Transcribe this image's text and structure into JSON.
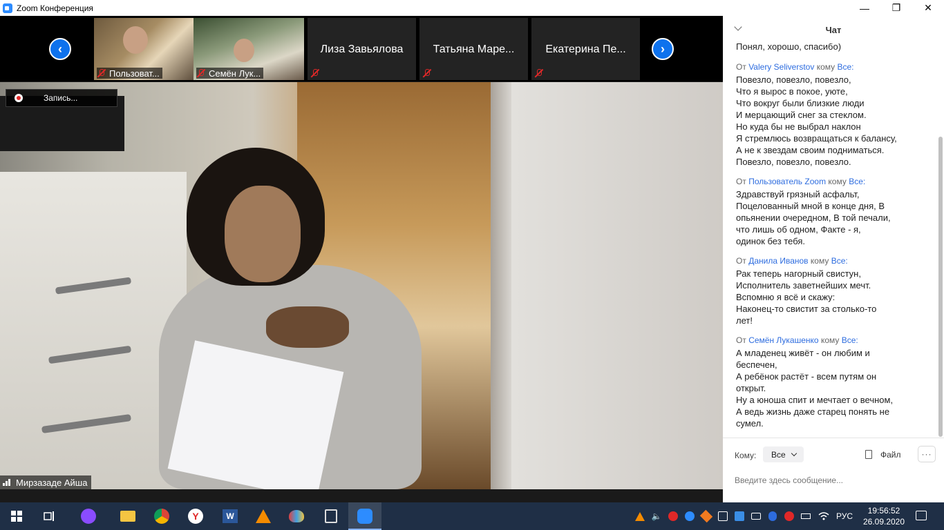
{
  "window": {
    "title": "Zoom Конференция",
    "minimize": "—",
    "maximize": "❐",
    "close": "✕"
  },
  "thumbnails": [
    {
      "name": "Пользоват...",
      "has_video": true
    },
    {
      "name": "Семён Лук...",
      "has_video": true
    },
    {
      "name": "Лиза Завьялова",
      "has_video": false
    },
    {
      "name": "Татьяна Маре...",
      "has_video": false
    },
    {
      "name": "Екатерина Пе...",
      "has_video": false
    }
  ],
  "nav": {
    "prev": "‹",
    "next": "›"
  },
  "recording": {
    "label": "Запись..."
  },
  "speaker": {
    "name": "Мирзазаде Айша"
  },
  "chat": {
    "title": "Чат",
    "cut_off_text": "Понял, хорошо, спасибо)",
    "messages": [
      {
        "from_prefix": "От",
        "user": "Valery Seliverstov",
        "to_prefix": "кому",
        "to": "Все:",
        "lines": [
          "Повезло, повезло, повезло,",
          "Что я вырос в покое, уюте,",
          "Что вокруг были близкие люди",
          "И мерцающий снег за стеклом.",
          "Но куда бы не выбрал наклон",
          "Я стремлюсь возвращаться к балансу,",
          "А не к звездам своим подниматься.",
          "Повезло, повезло, повезло."
        ]
      },
      {
        "from_prefix": "От",
        "user": "Пользователь Zoom",
        "to_prefix": "кому",
        "to": "Все:",
        "lines": [
          "Здравствуй грязный асфальт,",
          "Поцелованный мной в конце дня,  В",
          "опьянении очередном,  В той печали,",
          "что лишь об одном,  Факте - я,",
          "одинок без тебя."
        ]
      },
      {
        "from_prefix": "От",
        "user": "Данила Иванов",
        "to_prefix": "кому",
        "to": "Все:",
        "lines": [
          "Рак теперь нагорный свистун,",
          "Исполнитель заветнейших мечт.",
          "Вспомню я всё и скажу:",
          "Наконец-то свистит за столько-то",
          "лет!"
        ]
      },
      {
        "from_prefix": "От",
        "user": "Семён Лукашенко",
        "to_prefix": "кому",
        "to": "Все:",
        "lines": [
          "А младенец живёт - он любим и",
          "беспечен,",
          "А ребёнок растёт - всем путям он",
          "открыт.",
          "Ну а юноша спит и мечтает о вечном,",
          "А ведь жизнь даже старец понять не",
          "сумел."
        ]
      }
    ],
    "to_label": "Кому:",
    "to_value": "Все",
    "file_label": "Файл",
    "more_label": "···",
    "input_placeholder": "Введите здесь сообщение..."
  },
  "taskbar": {
    "start_icon": "windows-icon",
    "lang": "РУС",
    "time": "19:56:52",
    "date": "26.09.2020"
  }
}
